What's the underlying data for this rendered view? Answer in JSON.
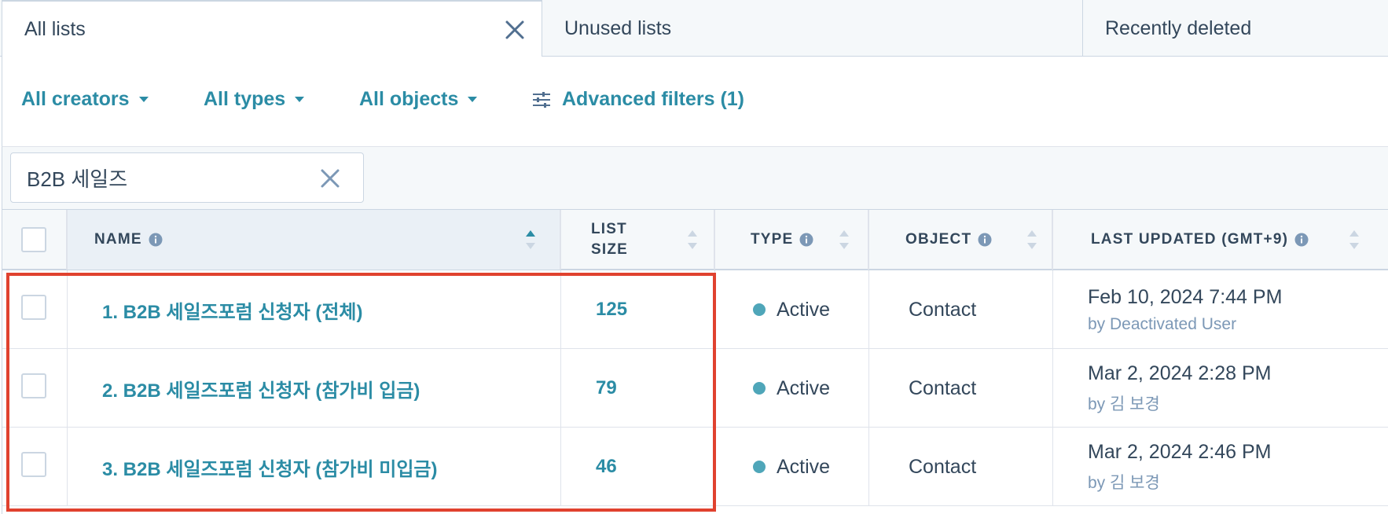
{
  "tabs": [
    {
      "label": "All lists",
      "active": true
    },
    {
      "label": "Unused lists",
      "active": false
    },
    {
      "label": "Recently deleted",
      "active": false
    }
  ],
  "filters": {
    "creators": "All creators",
    "types": "All types",
    "objects": "All objects",
    "advanced": "Advanced filters (1)"
  },
  "search": {
    "value": "B2B 세일즈"
  },
  "table": {
    "columns": {
      "name": "NAME",
      "list_size": "LIST SIZE",
      "type": "TYPE",
      "object": "OBJECT",
      "last_updated": "LAST UPDATED (GMT+9)"
    },
    "rows": [
      {
        "name": "1. B2B 세일즈포럼 신청자 (전체)",
        "size": "125",
        "type": "Active",
        "object": "Contact",
        "updated": "Feb 10, 2024 7:44 PM",
        "by": "by Deactivated User"
      },
      {
        "name": "2. B2B 세일즈포럼 신청자 (참가비 입금)",
        "size": "79",
        "type": "Active",
        "object": "Contact",
        "updated": "Mar 2, 2024 2:28 PM",
        "by": "by 김 보경"
      },
      {
        "name": "3. B2B 세일즈포럼 신청자 (참가비 미입금)",
        "size": "46",
        "type": "Active",
        "object": "Contact",
        "updated": "Mar 2, 2024 2:46 PM",
        "by": "by 김 보경"
      }
    ]
  },
  "colors": {
    "link": "#2b8ca5",
    "text": "#33475b",
    "muted": "#7c98b6",
    "status_active": "#4fa6b9",
    "highlight": "#e0422f",
    "border": "#cbd6e2"
  }
}
